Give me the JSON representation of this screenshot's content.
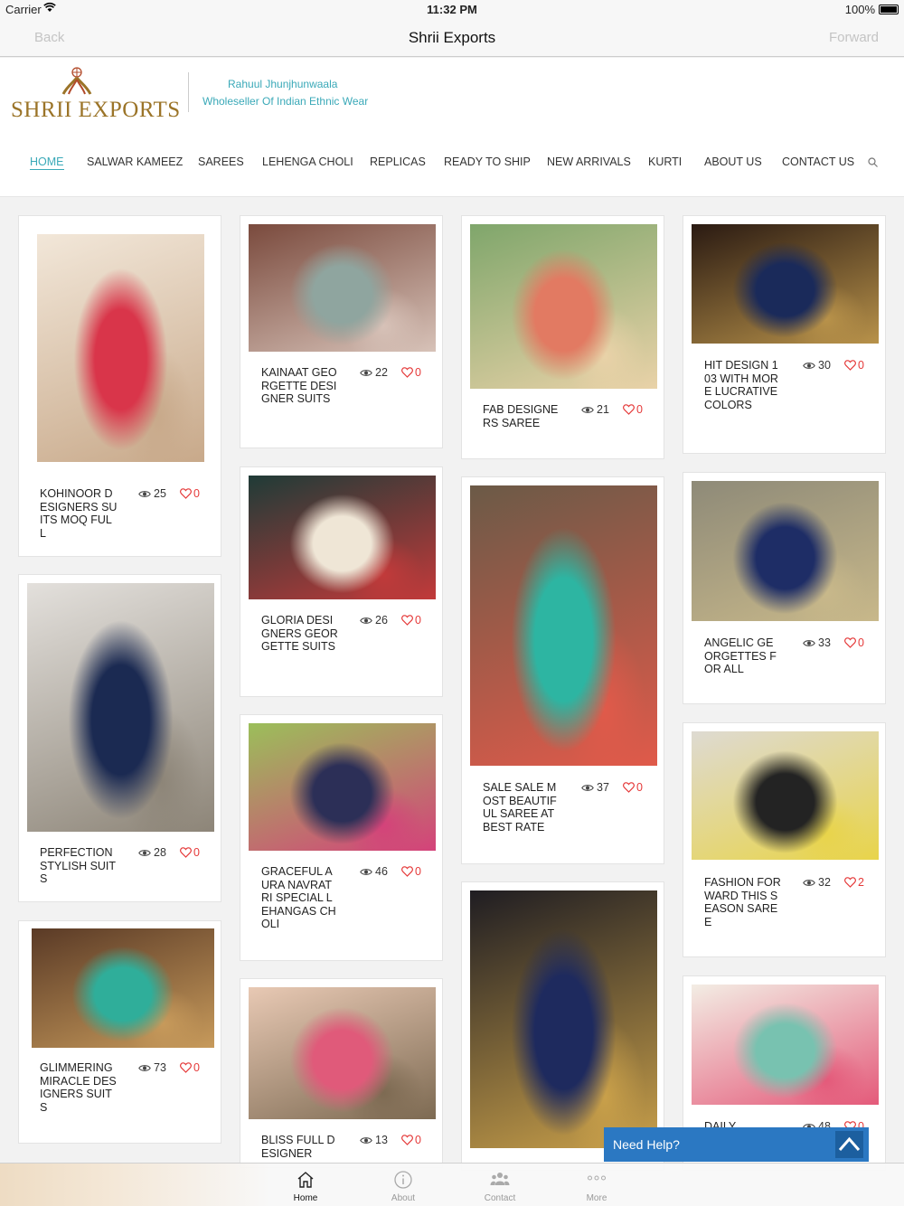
{
  "status_bar": {
    "carrier": "Carrier",
    "time": "11:32 PM",
    "battery": "100%"
  },
  "nav_bar": {
    "back": "Back",
    "title": "Shrii Exports",
    "forward": "Forward"
  },
  "site": {
    "logo_text": "SHRII EXPORTS",
    "owner": "Rahuul Jhunjhunwaala",
    "tagline": "Wholeseller Of Indian Ethnic Wear",
    "accent_color": "#3aa9b8",
    "menu": [
      "HOME",
      "SALWAR KAMEEZ",
      "SAREES",
      "LEHENGA CHOLI",
      "REPLICAS",
      "READY TO SHIP",
      "NEW ARRIVALS",
      "KURTI",
      "ABOUT US",
      "CONTACT US"
    ],
    "active_menu": "HOME"
  },
  "products": [
    {
      "title": "KOHINOOR DESIGNERS SUITS MOQ FULL",
      "views": "25",
      "likes": "0",
      "palette": [
        "#f2e7d9",
        "#d9354a",
        "#c8a98a"
      ]
    },
    {
      "title": "PERFECTION STYLISH SUITS",
      "views": "28",
      "likes": "0",
      "palette": [
        "#e3e0dc",
        "#1b2a52",
        "#8d8578"
      ]
    },
    {
      "title": "GLIMMERING MIRACLE DESIGNERS SUITS",
      "views": "73",
      "likes": "0",
      "palette": [
        "#5a3a26",
        "#2fae9a",
        "#c79a5b"
      ]
    },
    {
      "title": "KAINAAT GEORGETTE DESIGNER SUITS",
      "views": "22",
      "likes": "0",
      "palette": [
        "#7a4a3d",
        "#8fa59f",
        "#d7c2b8"
      ]
    },
    {
      "title": "GLORIA DESIGNERS GEORGETTE SUITS",
      "views": "26",
      "likes": "0",
      "palette": [
        "#1f3b37",
        "#efe6d6",
        "#c23a3a"
      ]
    },
    {
      "title": "GRACEFUL AURA NAVRATRI SPECIAL LEHANGAS CHOLI",
      "views": "46",
      "likes": "0",
      "palette": [
        "#9bbf5a",
        "#2c2f57",
        "#d4427a"
      ]
    },
    {
      "title": "BLISS FULL DESIGNER",
      "views": "13",
      "likes": "0",
      "palette": [
        "#e8c9b4",
        "#e05a7a",
        "#7d6a52"
      ]
    },
    {
      "title": "FAB DESIGNERS SAREE",
      "views": "21",
      "likes": "0",
      "palette": [
        "#7fa66b",
        "#e27a62",
        "#e9d2a8"
      ]
    },
    {
      "title": "SALE SALE MOST BEAUTIFUL SAREE AT BEST RATE",
      "views": "37",
      "likes": "0",
      "palette": [
        "#6b5a47",
        "#2db5a2",
        "#e05a4a"
      ]
    },
    {
      "title": "",
      "views": "",
      "likes": "",
      "palette": [
        "#1f1d22",
        "#1e2a5e",
        "#c9a04a"
      ]
    },
    {
      "title": "HIT DESIGN 103 WITH MORE LUCRATIVE COLORS",
      "views": "30",
      "likes": "0",
      "palette": [
        "#2a1a12",
        "#1a2a5a",
        "#b8924a"
      ]
    },
    {
      "title": "ANGELIC GEORGETTES FOR ALL",
      "views": "33",
      "likes": "0",
      "palette": [
        "#8e8a78",
        "#1e2d66",
        "#c8b88a"
      ]
    },
    {
      "title": "FASHION FORWARD THIS SEASON SAREE",
      "views": "32",
      "likes": "2",
      "palette": [
        "#dedad2",
        "#232323",
        "#e8d44a"
      ]
    },
    {
      "title": "DAILY",
      "views": "48",
      "likes": "0",
      "palette": [
        "#f3ede4",
        "#78c2b0",
        "#e45a7a"
      ]
    }
  ],
  "help_button": {
    "label": "Need Help?"
  },
  "tab_bar": {
    "tabs": [
      {
        "label": "Home",
        "icon": "home-icon"
      },
      {
        "label": "About",
        "icon": "info-icon"
      },
      {
        "label": "Contact",
        "icon": "people-icon"
      },
      {
        "label": "More",
        "icon": "more-icon"
      }
    ],
    "active": "Home"
  }
}
